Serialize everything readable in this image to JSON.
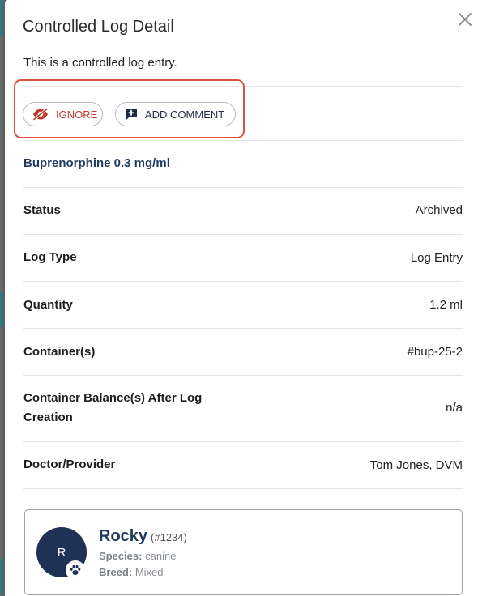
{
  "modal": {
    "title": "Controlled Log Detail",
    "subtitle": "This is a controlled log entry.",
    "close_icon": "close-icon"
  },
  "actions": {
    "ignore_label": "IGNORE",
    "ignore_icon": "eye-off-icon",
    "ignore_color": "#c0392b",
    "comment_label": "ADD COMMENT",
    "comment_icon": "comment-add-icon",
    "highlight_color": "#d9543f"
  },
  "drug_name": "Buprenorphine 0.3 mg/ml",
  "details": [
    {
      "label": "Status",
      "value": "Archived"
    },
    {
      "label": "Log Type",
      "value": "Log Entry"
    },
    {
      "label": "Quantity",
      "value": "1.2 ml"
    },
    {
      "label": "Container(s)",
      "value": "#bup-25-2"
    },
    {
      "label_line1": "Container Balance(s) After Log",
      "label_line2": "Creation",
      "value": "n/a"
    },
    {
      "label": "Doctor/Provider",
      "value": "Tom Jones, DVM"
    }
  ],
  "patient": {
    "initial": "R",
    "name": "Rocky",
    "id": "(#1234)",
    "species_label": "Species:",
    "species": "canine",
    "breed_label": "Breed:",
    "breed": "Mixed",
    "badge_icon": "paw-icon",
    "avatar_color": "#1f3256"
  }
}
